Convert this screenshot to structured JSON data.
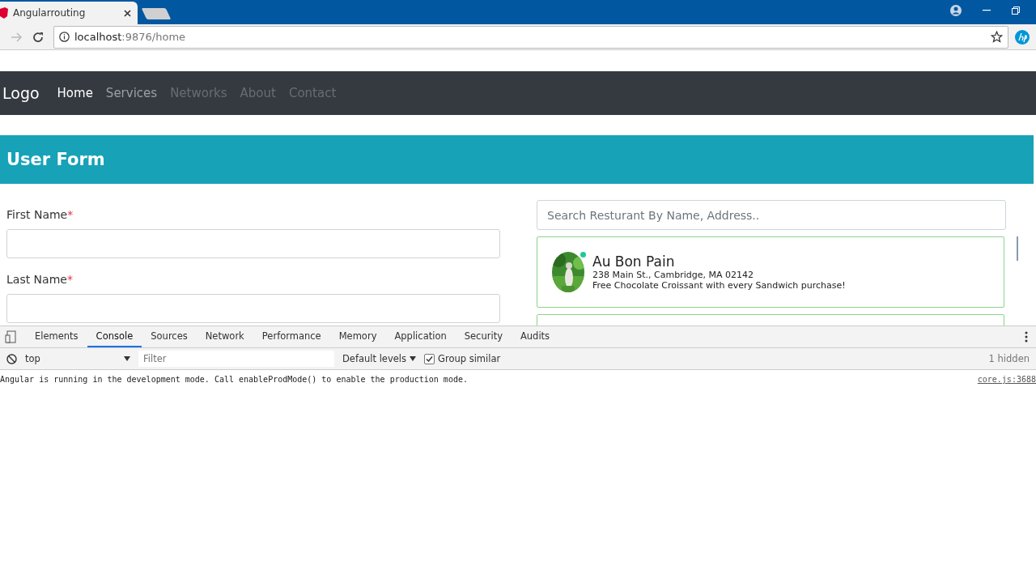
{
  "browser": {
    "tab_title": "Angularrouting",
    "address_host": "localhost",
    "address_path": ":9876/home"
  },
  "navbar": {
    "brand": "Logo",
    "links": [
      {
        "label": "Home",
        "active": true,
        "disabled": false
      },
      {
        "label": "Services",
        "active": false,
        "disabled": false
      },
      {
        "label": "Networks",
        "active": false,
        "disabled": true
      },
      {
        "label": "About",
        "active": false,
        "disabled": true
      },
      {
        "label": "Contact",
        "active": false,
        "disabled": true
      }
    ]
  },
  "form": {
    "title": "User Form",
    "fields": [
      {
        "label": "First Name",
        "required_mark": "*"
      },
      {
        "label": "Last Name",
        "required_mark": "*"
      }
    ]
  },
  "search": {
    "placeholder": "Search Resturant By Name, Address.."
  },
  "restaurants": [
    {
      "name": "Au Bon Pain",
      "address": "238 Main St., Cambridge, MA 02142",
      "offer": "Free Chocolate Croissant with every Sandwich purchase!",
      "online": true
    }
  ],
  "devtools": {
    "tabs": [
      {
        "label": "Elements",
        "selected": false
      },
      {
        "label": "Console",
        "selected": true
      },
      {
        "label": "Sources",
        "selected": false
      },
      {
        "label": "Network",
        "selected": false
      },
      {
        "label": "Performance",
        "selected": false
      },
      {
        "label": "Memory",
        "selected": false
      },
      {
        "label": "Application",
        "selected": false
      },
      {
        "label": "Security",
        "selected": false
      },
      {
        "label": "Audits",
        "selected": false
      }
    ],
    "context": "top",
    "filter_placeholder": "Filter",
    "levels": "Default levels",
    "group_similar": {
      "label": "Group similar",
      "checked": true
    },
    "hidden_count": "1 hidden",
    "messages": [
      {
        "text": "Angular is running in the development mode. Call enableProdMode() to enable the production mode.",
        "source": "core.js:3688"
      }
    ]
  }
}
